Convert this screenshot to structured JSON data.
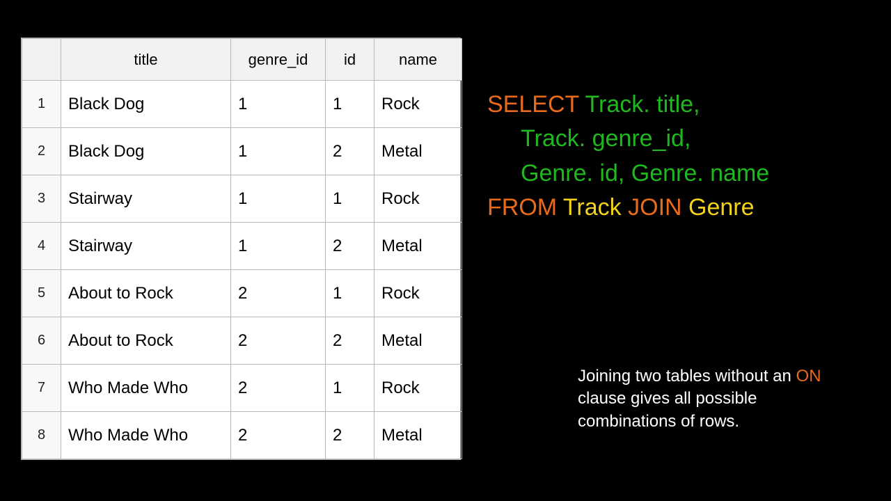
{
  "table": {
    "headers": {
      "title": "title",
      "genre_id": "genre_id",
      "id": "id",
      "name": "name"
    },
    "rows": [
      {
        "n": "1",
        "title": "Black Dog",
        "genre_id": "1",
        "id": "1",
        "name": "Rock"
      },
      {
        "n": "2",
        "title": "Black Dog",
        "genre_id": "1",
        "id": "2",
        "name": "Metal"
      },
      {
        "n": "3",
        "title": "Stairway",
        "genre_id": "1",
        "id": "1",
        "name": "Rock"
      },
      {
        "n": "4",
        "title": "Stairway",
        "genre_id": "1",
        "id": "2",
        "name": "Metal"
      },
      {
        "n": "5",
        "title": "About to Rock",
        "genre_id": "2",
        "id": "1",
        "name": "Rock"
      },
      {
        "n": "6",
        "title": "About to Rock",
        "genre_id": "2",
        "id": "2",
        "name": "Metal"
      },
      {
        "n": "7",
        "title": "Who Made Who",
        "genre_id": "2",
        "id": "1",
        "name": "Rock"
      },
      {
        "n": "8",
        "title": "Who Made Who",
        "genre_id": "2",
        "id": "2",
        "name": "Metal"
      }
    ]
  },
  "sql": {
    "select": "SELECT",
    "col1": " Track. title, ",
    "col2": "Track. genre_id, ",
    "col3": "Genre. id, Genre. name",
    "from": "FROM",
    "table1": " Track ",
    "join": "JOIN",
    "table2": " Genre"
  },
  "note": {
    "t1": "Joining two tables without an ",
    "on": "ON",
    "t2": " clause gives all possible combinations of rows."
  }
}
